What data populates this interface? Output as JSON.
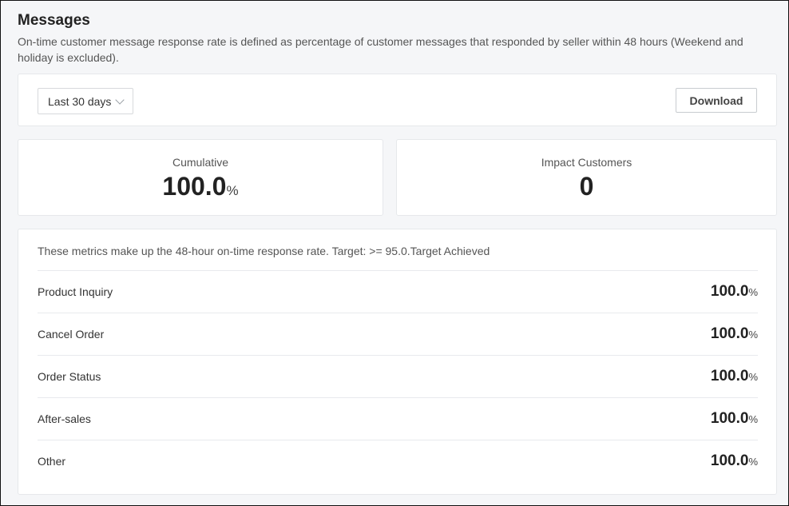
{
  "header": {
    "title": "Messages",
    "description": "On-time customer message response rate is defined as percentage of customer messages that responded by seller within 48 hours (Weekend and holiday is excluded)."
  },
  "filter": {
    "range_label": "Last 30 days",
    "download_label": "Download"
  },
  "stats": {
    "cumulative": {
      "label": "Cumulative",
      "value": "100.0",
      "unit": "%"
    },
    "impact": {
      "label": "Impact Customers",
      "value": "0"
    }
  },
  "metrics": {
    "note": "These metrics make up the 48-hour on-time response rate. Target: >= 95.0.Target Achieved",
    "rows": [
      {
        "label": "Product Inquiry",
        "value": "100.0",
        "unit": "%"
      },
      {
        "label": "Cancel Order",
        "value": "100.0",
        "unit": "%"
      },
      {
        "label": "Order Status",
        "value": "100.0",
        "unit": "%"
      },
      {
        "label": "After-sales",
        "value": "100.0",
        "unit": "%"
      },
      {
        "label": "Other",
        "value": "100.0",
        "unit": "%"
      }
    ]
  }
}
